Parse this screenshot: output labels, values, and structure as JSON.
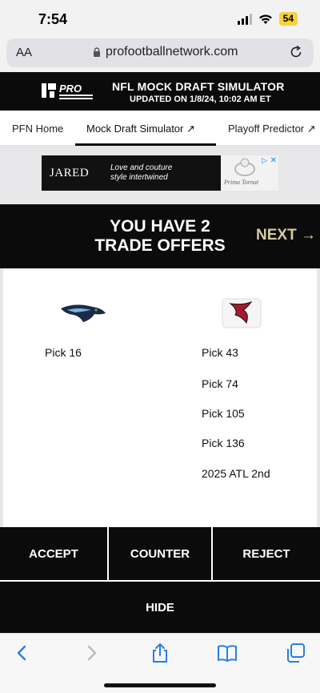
{
  "status_bar": {
    "time": "7:54",
    "battery": "54"
  },
  "browser": {
    "aa_label": "AA",
    "url": "profootballnetwork.com"
  },
  "site_header": {
    "logo_text": "PRO",
    "title": "NFL MOCK DRAFT SIMULATOR",
    "subtitle": "UPDATED ON 1/8/24, 10:02 AM ET"
  },
  "nav": {
    "items": [
      {
        "label": "PFN Home"
      },
      {
        "label": "Mock Draft Simulator ↗"
      },
      {
        "label": "Playoff Predictor ↗"
      }
    ]
  },
  "ad": {
    "brand": "JARED",
    "text_line1": "Love and couture",
    "text_line2": "style intertwined",
    "signature": "Prima Tornat"
  },
  "modal": {
    "title_line1": "YOU HAVE 2",
    "title_line2": "TRADE OFFERS",
    "next_label": "NEXT →",
    "left_team": {
      "icon": "seahawks-logo",
      "picks": [
        "Pick 16"
      ]
    },
    "right_team": {
      "icon": "falcons-logo",
      "picks": [
        "Pick 43",
        "Pick 74",
        "Pick 105",
        "Pick 136",
        "2025 ATL 2nd"
      ]
    },
    "buttons": {
      "accept": "ACCEPT",
      "counter": "COUNTER",
      "reject": "REJECT",
      "hide": "HIDE"
    }
  },
  "toolbar_icons": [
    "back-icon",
    "forward-icon",
    "share-icon",
    "bookmarks-icon",
    "tabs-icon"
  ],
  "colors": {
    "dark": "#0b0b0c",
    "next_gold": "#d8c9a0",
    "battery": "#f5d33b",
    "ios_blue": "#2a7ee6"
  }
}
